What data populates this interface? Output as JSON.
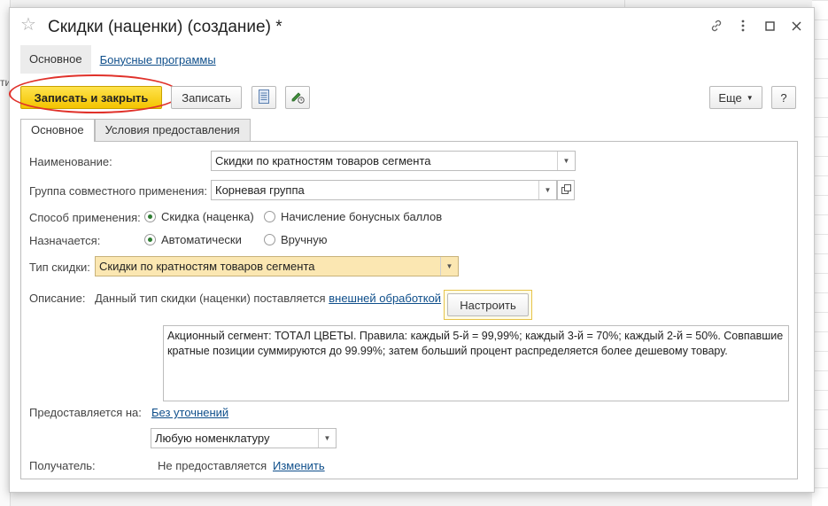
{
  "background": {
    "left_text": "ти"
  },
  "window": {
    "title": "Скидки (наценки) (создание) *",
    "icons": [
      "star-icon",
      "link-icon",
      "more-icon",
      "maximize-icon",
      "close-icon"
    ]
  },
  "nav": {
    "active": "Основное",
    "link": "Бонусные программы"
  },
  "toolbar": {
    "save_close": "Записать и закрыть",
    "save": "Записать",
    "more": "Еще",
    "help": "?"
  },
  "tabs": [
    {
      "label": "Основное",
      "active": true
    },
    {
      "label": "Условия предоставления",
      "active": false
    }
  ],
  "form": {
    "name_label": "Наименование:",
    "name_value": "Скидки по кратностям товаров сегмента",
    "group_label": "Группа совместного применения:",
    "group_value": "Корневая группа",
    "method_label": "Способ применения:",
    "method_options": [
      "Скидка (наценка)",
      "Начисление бонусных баллов"
    ],
    "method_selected": 0,
    "assign_label": "Назначается:",
    "assign_options": [
      "Автоматически",
      "Вручную"
    ],
    "assign_selected": 0,
    "type_label": "Тип скидки:",
    "type_value": "Скидки по кратностям товаров сегмента",
    "desc_label": "Описание:",
    "desc_text": "Данный тип скидки (наценки) поставляется",
    "desc_link": "внешней обработкой",
    "setup_button": "Настроить",
    "memo": "Акционный сегмент: ТОТАЛ ЦВЕТЫ. Правила: каждый 5-й = 99,99%; каждый 3-й = 70%; каждый 2-й = 50%. Совпавшие кратные позиции суммируются до 99.99%; затем больший процент распределяется более дешевому товару.",
    "provided_label": "Предоставляется на:",
    "provided_link": "Без уточнений",
    "nomenclature_value": "Любую номенклатуру",
    "recipient_label": "Получатель:",
    "recipient_value": "Не предоставляется",
    "recipient_link": "Изменить"
  },
  "colors": {
    "primary_button": "#f3c400",
    "highlight_field": "#fbe7b2",
    "link": "#0f4f8b",
    "annotation_ellipse": "#e0312a",
    "radio_selected": "#2e7d32"
  }
}
